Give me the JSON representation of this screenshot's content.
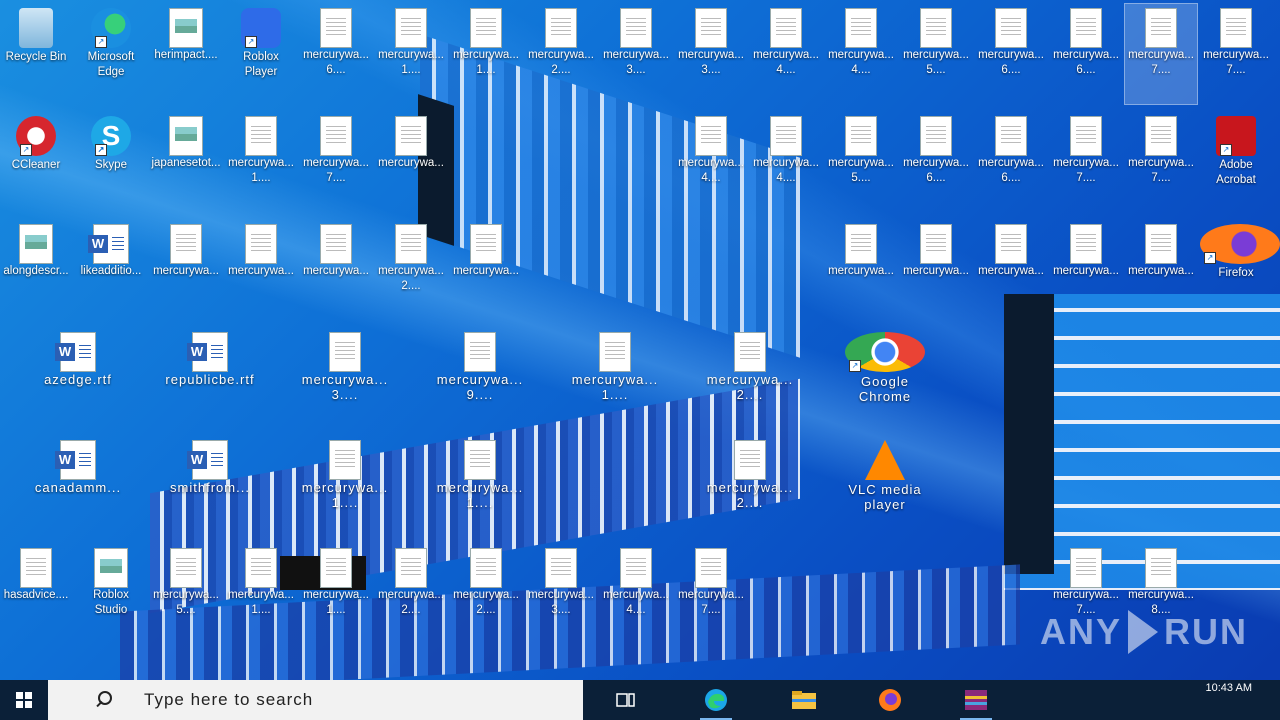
{
  "desktop": {
    "icons": [
      {
        "label": "Recycle Bin",
        "type": "recycle"
      },
      {
        "label": "Microsoft\nEdge",
        "type": "edge"
      },
      {
        "label": "herimpact....",
        "type": "image"
      },
      {
        "label": "Roblox\nPlayer",
        "type": "roblox"
      },
      {
        "label": "mercurywa...\n6....",
        "type": "doc"
      },
      {
        "label": "mercurywa...\n1....",
        "type": "doc"
      },
      {
        "label": "mercurywa...\n1....",
        "type": "doc"
      },
      {
        "label": "mercurywa...\n2....",
        "type": "doc"
      },
      {
        "label": "mercurywa...\n3....",
        "type": "doc"
      },
      {
        "label": "mercurywa...\n3....",
        "type": "doc"
      },
      {
        "label": "mercurywa...\n4....",
        "type": "doc"
      },
      {
        "label": "mercurywa...\n4....",
        "type": "doc"
      },
      {
        "label": "mercurywa...\n5....",
        "type": "doc"
      },
      {
        "label": "mercurywa...\n6....",
        "type": "doc"
      },
      {
        "label": "mercurywa...\n6....",
        "type": "doc"
      },
      {
        "label": "mercurywa...\n7....",
        "type": "doc",
        "selected": true
      },
      {
        "label": "mercurywa...\n7....",
        "type": "doc"
      },
      {
        "label": "CCleaner",
        "type": "ccleaner"
      },
      {
        "label": "Skype",
        "type": "skype"
      },
      {
        "label": "japanesetot...",
        "type": "image"
      },
      {
        "label": "mercurywa...\n1....",
        "type": "doc"
      },
      {
        "label": "mercurywa...\n7....",
        "type": "doc"
      },
      {
        "label": "mercurywa...",
        "type": "doc"
      },
      {
        "label": "mercurywa...\n4....",
        "type": "doc"
      },
      {
        "label": "mercurywa...\n4....",
        "type": "doc"
      },
      {
        "label": "mercurywa...\n5....",
        "type": "doc"
      },
      {
        "label": "mercurywa...\n6....",
        "type": "doc"
      },
      {
        "label": "mercurywa...\n6....",
        "type": "doc"
      },
      {
        "label": "mercurywa...\n7....",
        "type": "doc"
      },
      {
        "label": "mercurywa...\n7....",
        "type": "doc"
      },
      {
        "label": "Adobe\nAcrobat",
        "type": "adobe"
      },
      {
        "label": "alongdescr...",
        "type": "image"
      },
      {
        "label": "likeadditio...",
        "type": "word"
      },
      {
        "label": "mercurywa...",
        "type": "doc"
      },
      {
        "label": "mercurywa...",
        "type": "doc"
      },
      {
        "label": "mercurywa...",
        "type": "doc"
      },
      {
        "label": "mercurywa...\n2....",
        "type": "doc"
      },
      {
        "label": "mercurywa...",
        "type": "doc"
      },
      {
        "label": "mercurywa...",
        "type": "doc"
      },
      {
        "label": "mercurywa...",
        "type": "doc"
      },
      {
        "label": "mercurywa...",
        "type": "doc"
      },
      {
        "label": "mercurywa...",
        "type": "doc"
      },
      {
        "label": "mercurywa...",
        "type": "doc"
      },
      {
        "label": "Firefox",
        "type": "firefox"
      },
      {
        "label": "azedge.rtf",
        "type": "word"
      },
      {
        "label": "republicbe.rtf",
        "type": "word"
      },
      {
        "label": "mercurywa...\n3....",
        "type": "doc"
      },
      {
        "label": "mercurywa...\n9....",
        "type": "doc"
      },
      {
        "label": "mercurywa...\n1....",
        "type": "doc"
      },
      {
        "label": "mercurywa...\n2....",
        "type": "doc"
      },
      {
        "label": "Google\nChrome",
        "type": "chrome"
      },
      {
        "label": "canadamm...",
        "type": "word"
      },
      {
        "label": "smithfrom...",
        "type": "word"
      },
      {
        "label": "mercurywa...\n1....",
        "type": "doc"
      },
      {
        "label": "mercurywa...\n1....",
        "type": "doc"
      },
      {
        "label": "mercurywa...\n2....",
        "type": "doc"
      },
      {
        "label": "VLC media\nplayer",
        "type": "vlc"
      },
      {
        "label": "hasadvice....",
        "type": "doc"
      },
      {
        "label": "Roblox\nStudio",
        "type": "image"
      },
      {
        "label": "mercurywa...\n5....",
        "type": "doc"
      },
      {
        "label": "mercurywa...\n1....",
        "type": "doc"
      },
      {
        "label": "mercurywa...\n1....",
        "type": "doc"
      },
      {
        "label": "mercurywa...\n2....",
        "type": "doc"
      },
      {
        "label": "mercurywa...\n2....",
        "type": "doc"
      },
      {
        "label": "mercurywa...\n3....",
        "type": "doc"
      },
      {
        "label": "mercurywa...\n4....",
        "type": "doc"
      },
      {
        "label": "mercurywa...\n7....",
        "type": "doc"
      },
      {
        "label": "mercurywa...\n7....",
        "type": "doc"
      },
      {
        "label": "mercurywa...\n8....",
        "type": "doc"
      }
    ]
  },
  "taskbar": {
    "search_placeholder": "Type here to search",
    "clock": "10:43 AM",
    "pinned": [
      "task-view-icon",
      "edge-icon",
      "file-explorer-icon",
      "firefox-icon",
      "winrar-icon"
    ]
  },
  "watermark": "ANY RUN",
  "colors": {
    "taskbar": "#0b2038",
    "desktop": "#0e6fd6",
    "search": "#f2f2f2"
  }
}
